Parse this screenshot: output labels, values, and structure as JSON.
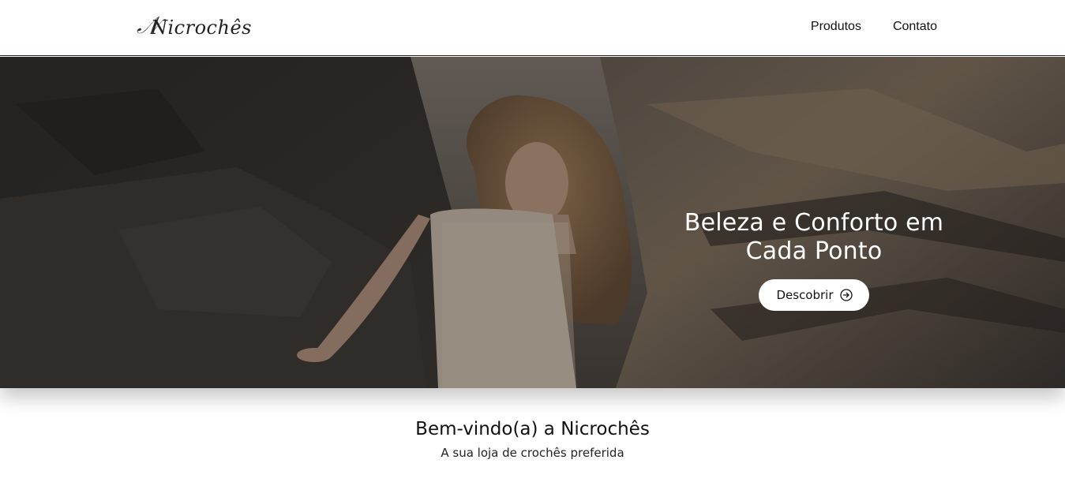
{
  "header": {
    "logo_text": "Nicrochês",
    "nav": [
      {
        "label": "Produtos"
      },
      {
        "label": "Contato"
      }
    ]
  },
  "hero": {
    "title_line1": "Beleza e Conforto em",
    "title_line2": "Cada Ponto",
    "cta_label": "Descobrir",
    "cta_icon": "arrow-right-circle-icon"
  },
  "welcome": {
    "title": "Bem-vindo(a) a Nicrochês",
    "subtitle": "A sua loja de crochês preferida"
  },
  "colors": {
    "overlay": "#141210",
    "button_bg": "#ffffff",
    "text_dark": "#111111"
  }
}
